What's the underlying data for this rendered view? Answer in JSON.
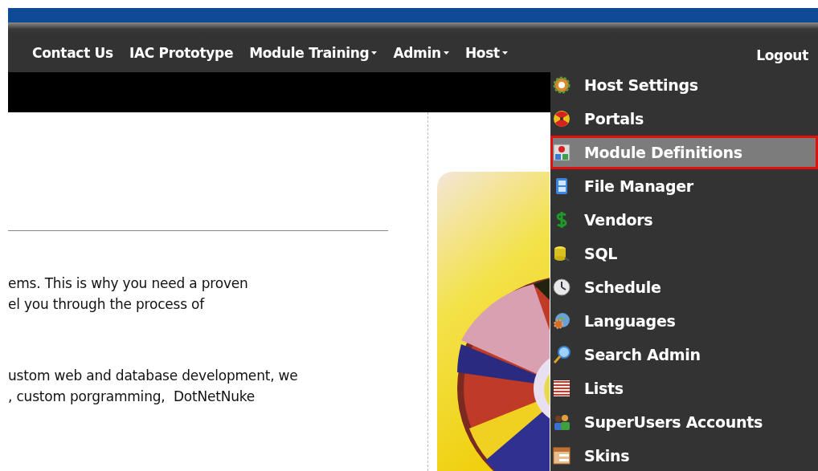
{
  "nav": {
    "items": [
      {
        "label": "Contact Us",
        "has_menu": false
      },
      {
        "label": "IAC Prototype",
        "has_menu": false
      },
      {
        "label": "Module Training",
        "has_menu": true
      },
      {
        "label": "Admin",
        "has_menu": true
      },
      {
        "label": "Host",
        "has_menu": true
      }
    ],
    "logout": "Logout"
  },
  "content": {
    "paragraphs": [
      [
        "ems. This is why you need a proven",
        "el you through the process of"
      ],
      [
        "ustom web and database development, we",
        ", custom porgramming,  DotNetNuke"
      ]
    ]
  },
  "host_menu": {
    "items": [
      {
        "label": "Host Settings",
        "selected": false
      },
      {
        "label": "Portals",
        "selected": false
      },
      {
        "label": "Module Definitions",
        "selected": true
      },
      {
        "label": "File Manager",
        "selected": false
      },
      {
        "label": "Vendors",
        "selected": false
      },
      {
        "label": "SQL",
        "selected": false
      },
      {
        "label": "Schedule",
        "selected": false
      },
      {
        "label": "Languages",
        "selected": false
      },
      {
        "label": "Search Admin",
        "selected": false
      },
      {
        "label": "Lists",
        "selected": false
      },
      {
        "label": "SuperUsers Accounts",
        "selected": false
      },
      {
        "label": "Skins",
        "selected": false
      }
    ]
  }
}
